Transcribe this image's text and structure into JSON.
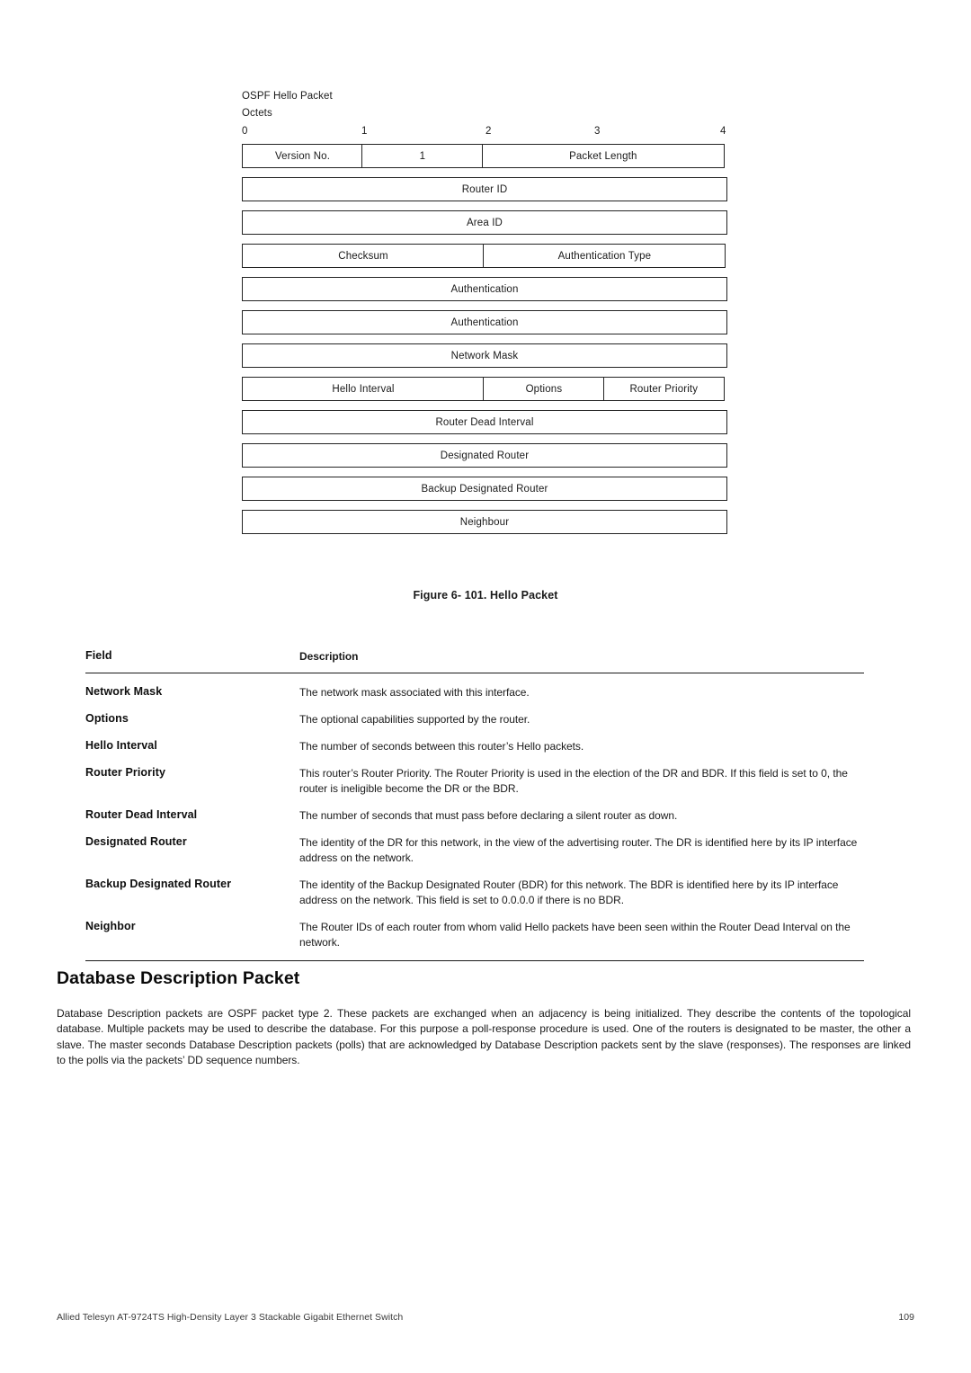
{
  "figure": {
    "title": "OSPF Hello Packet",
    "axis_label": "Octets",
    "ticks": [
      "0",
      "1",
      "2",
      "3",
      "4"
    ],
    "caption": "Figure 6- 101. Hello Packet",
    "rows": [
      {
        "cells": [
          {
            "label": "Version No.",
            "span": 1
          },
          {
            "label": "1",
            "span": 1
          },
          {
            "label": "Packet Length",
            "span": 2
          }
        ]
      },
      {
        "cells": [
          {
            "label": "Router ID",
            "span": 4
          }
        ]
      },
      {
        "cells": [
          {
            "label": "Area ID",
            "span": 4
          }
        ]
      },
      {
        "cells": [
          {
            "label": "Checksum",
            "span": 2
          },
          {
            "label": "Authentication Type",
            "span": 2
          }
        ]
      },
      {
        "cells": [
          {
            "label": "Authentication",
            "span": 4
          }
        ]
      },
      {
        "cells": [
          {
            "label": "Authentication",
            "span": 4
          }
        ]
      },
      {
        "cells": [
          {
            "label": "Network Mask",
            "span": 4
          }
        ]
      },
      {
        "cells": [
          {
            "label": "Hello Interval",
            "span": 2
          },
          {
            "label": "Options",
            "span": 1
          },
          {
            "label": "Router Priority",
            "span": 1
          }
        ]
      },
      {
        "cells": [
          {
            "label": "Router Dead Interval",
            "span": 4
          }
        ]
      },
      {
        "cells": [
          {
            "label": "Designated Router",
            "span": 4
          }
        ]
      },
      {
        "cells": [
          {
            "label": "Backup Designated Router",
            "span": 4
          }
        ]
      },
      {
        "cells": [
          {
            "label": "Neighbour",
            "span": 4
          }
        ]
      }
    ]
  },
  "field_table": {
    "headers": {
      "field": "Field",
      "description": "Description"
    },
    "rows": [
      {
        "field": "Network Mask",
        "description": "The network mask associated with this interface."
      },
      {
        "field": "Options",
        "description": "The optional capabilities supported by the router."
      },
      {
        "field": "Hello Interval",
        "description": "The number of seconds between this router’s Hello packets."
      },
      {
        "field": "Router Priority",
        "description": "This router’s Router Priority. The Router Priority is used in the election of the DR and BDR. If this field is set to 0, the router is ineligible become the DR or the BDR."
      },
      {
        "field": "Router Dead Interval",
        "description": "The number of seconds that must pass before declaring a silent router as down."
      },
      {
        "field": "Designated Router",
        "description": "The identity of the DR for this network, in the view of the advertising router. The DR is identified here by its IP interface address on the network."
      },
      {
        "field": "Backup Designated Router",
        "description": "The identity of the Backup Designated Router (BDR) for this network. The BDR is identified here by its IP interface address on the network. This field is set to 0.0.0.0 if there is no BDR."
      },
      {
        "field": "Neighbor",
        "description": "The Router IDs of each router from whom valid Hello packets have been seen within the Router Dead Interval on the network."
      }
    ]
  },
  "section": {
    "heading": "Database Description Packet",
    "body": "Database Description packets are OSPF packet type 2. These packets are exchanged when an adjacency is being initialized. They describe the contents of the topological database. Multiple packets may be used to describe the database. For this purpose a poll-response procedure is used. One of the routers is designated to be master, the other a slave. The master seconds Database Description packets (polls) that are acknowledged by Database Description packets sent by the slave (responses). The responses are linked to the polls via the packets’ DD sequence numbers."
  },
  "footer": {
    "left": "Allied Telesyn AT-9724TS High-Density Layer 3 Stackable Gigabit Ethernet Switch",
    "page_number": "109"
  }
}
